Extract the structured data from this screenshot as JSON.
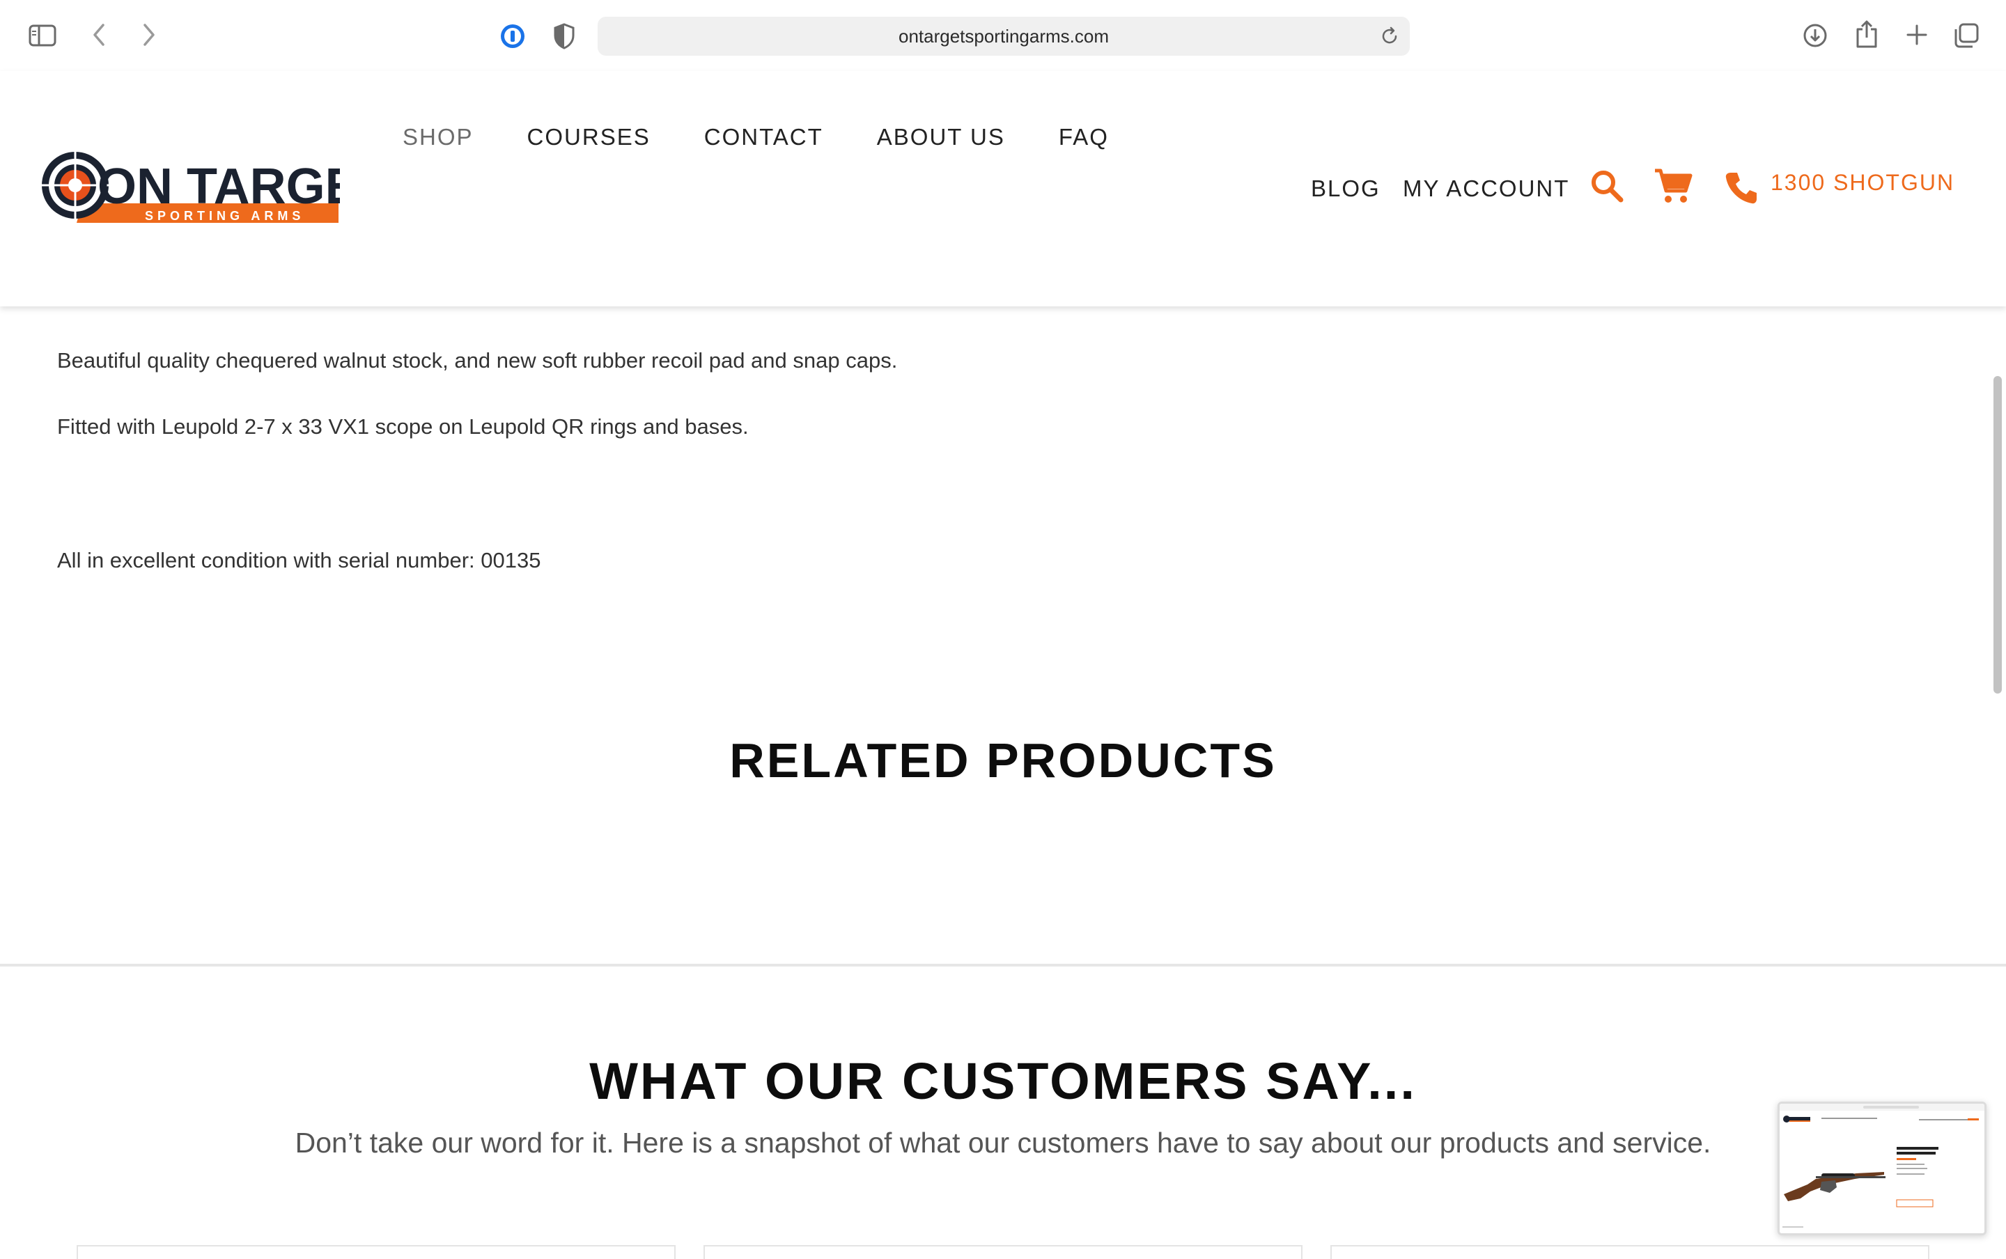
{
  "browser": {
    "url": "ontargetsportingarms.com"
  },
  "header": {
    "logo_text": "ON TARGET",
    "logo_subtext": "SPORTING ARMS",
    "nav_top": [
      {
        "label": "SHOP",
        "active": true
      },
      {
        "label": "COURSES",
        "active": false
      },
      {
        "label": "CONTACT",
        "active": false
      },
      {
        "label": "ABOUT US",
        "active": false
      },
      {
        "label": "FAQ",
        "active": false
      }
    ],
    "nav_right": [
      {
        "label": "BLOG"
      },
      {
        "label": "MY ACCOUNT"
      }
    ],
    "phone": "1300 SHOTGUN"
  },
  "product": {
    "description": [
      "Beautiful quality chequered walnut stock, and new soft rubber recoil pad and snap caps.",
      "Fitted with Leupold 2-7 x 33 VX1 scope on Leupold QR rings and bases.",
      "All in excellent condition with serial number: 00135"
    ]
  },
  "related": {
    "title": "RELATED PRODUCTS"
  },
  "testimonials": {
    "title": "WHAT OUR CUSTOMERS SAY...",
    "subtitle": "Don’t take our word for it. Here is a snapshot of what our customers have to say about our products and service."
  },
  "colors": {
    "accent": "#ee6a1c",
    "dark_navy": "#1b2230",
    "text": "#222222"
  }
}
